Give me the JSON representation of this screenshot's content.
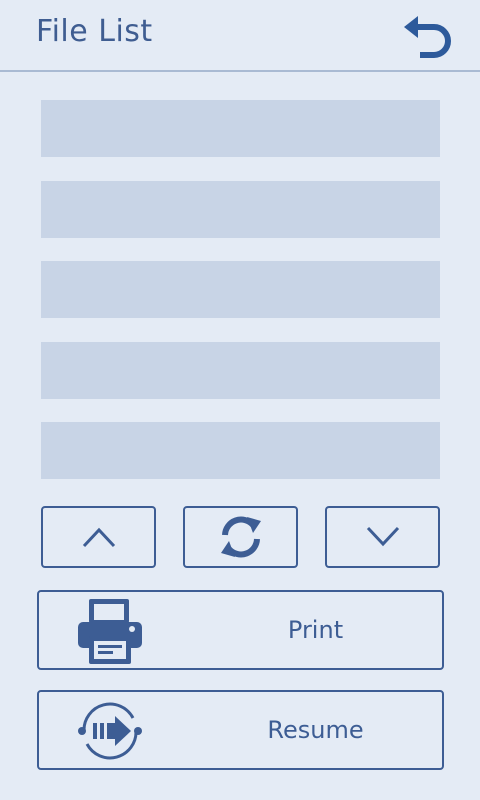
{
  "header": {
    "title": "File List",
    "back_icon": "back-arrow-icon"
  },
  "file_list": {
    "slots": [
      "",
      "",
      "",
      "",
      ""
    ]
  },
  "navigation": {
    "up_icon": "chevron-up-icon",
    "refresh_icon": "refresh-icon",
    "down_icon": "chevron-down-icon"
  },
  "actions": {
    "print_label": "Print",
    "print_icon": "printer-icon",
    "resume_label": "Resume",
    "resume_icon": "resume-icon"
  },
  "colors": {
    "background": "#e4ebf5",
    "accent": "#3d5d94",
    "slot": "#c8d4e6",
    "divider": "#a9bad3"
  }
}
